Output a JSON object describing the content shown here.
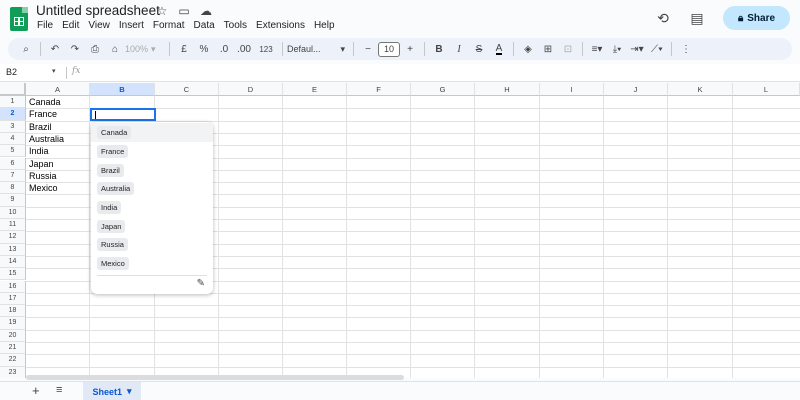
{
  "app": {
    "title": "Untitled spreadsheet",
    "menu": [
      "File",
      "Edit",
      "View",
      "Insert",
      "Format",
      "Data",
      "Tools",
      "Extensions",
      "Help"
    ],
    "share_label": "Share"
  },
  "toolbar": {
    "zoom": "100%",
    "currency": "£",
    "percent": "%",
    "decrease_decimal": ".0",
    "increase_decimal": ".00",
    "number_format": "123",
    "font": "Defaul...",
    "font_size": "10",
    "bold": "B",
    "italic": "I",
    "strikethrough": "S",
    "text_color": "A"
  },
  "formula_bar": {
    "name_box": "B2",
    "fx": "fx",
    "value": ""
  },
  "grid": {
    "columns": [
      "A",
      "B",
      "C",
      "D",
      "E",
      "F",
      "G",
      "H",
      "I",
      "J",
      "K",
      "L"
    ],
    "selected_column": "B",
    "selected_row": "2",
    "rows": [
      "1",
      "2",
      "3",
      "4",
      "5",
      "6",
      "7",
      "8",
      "9",
      "10",
      "11",
      "12",
      "13",
      "14",
      "15",
      "16",
      "17",
      "18",
      "19",
      "20",
      "21",
      "22",
      "23"
    ],
    "column_a": [
      "Canada",
      "France",
      "Brazil",
      "Australia",
      "India",
      "Japan",
      "Russia",
      "Mexico"
    ]
  },
  "dropdown": {
    "options": [
      "Canada",
      "France",
      "Brazil",
      "Australia",
      "India",
      "Japan",
      "Russia",
      "Mexico"
    ],
    "highlighted": "Canada",
    "chip_color": "#e8eaed"
  },
  "sheets": {
    "tabs": [
      {
        "label": "Sheet1",
        "active": true
      }
    ]
  },
  "colors": {
    "accent": "#1a73e8",
    "share_bg": "#c2e7ff",
    "sheets_green": "#0f9d58",
    "toolbar_bg": "#edf2fa"
  }
}
